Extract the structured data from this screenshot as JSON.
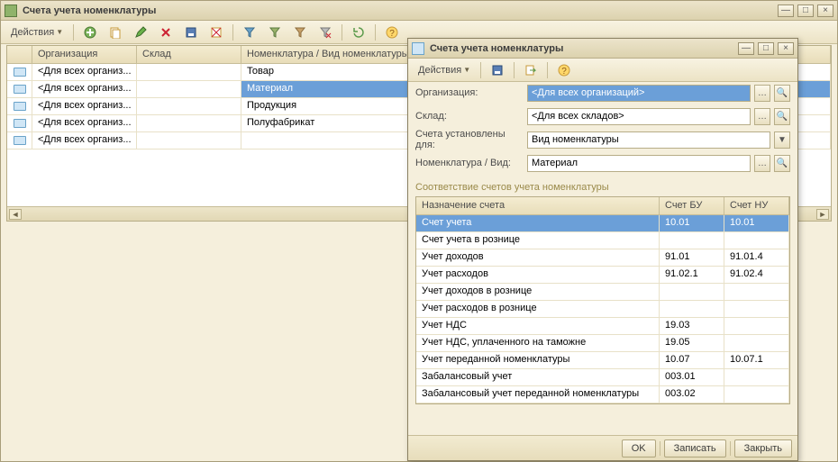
{
  "main": {
    "title": "Счета учета номенклатуры",
    "actions_label": "Действия",
    "columns": {
      "org": "Организация",
      "warehouse": "Склад",
      "nomen": "Номенклатура / Вид номенклатуры"
    },
    "rows": [
      {
        "org": "<Для всех организ...",
        "warehouse": "",
        "nomen": "Товар",
        "selected": false
      },
      {
        "org": "<Для всех организ...",
        "warehouse": "",
        "nomen": "Материал",
        "selected": true
      },
      {
        "org": "<Для всех организ...",
        "warehouse": "",
        "nomen": "Продукция",
        "selected": false
      },
      {
        "org": "<Для всех организ...",
        "warehouse": "",
        "nomen": "Полуфабрикат",
        "selected": false
      },
      {
        "org": "<Для всех организ...",
        "warehouse": "",
        "nomen": "",
        "selected": false
      }
    ]
  },
  "dialog": {
    "title": "Счета учета номенклатуры",
    "actions_label": "Действия",
    "fields": {
      "org_label": "Организация:",
      "org_value": "<Для всех организаций>",
      "warehouse_label": "Склад:",
      "warehouse_value": "<Для всех складов>",
      "setfor_label": "Счета установлены для:",
      "setfor_value": "Вид номенклатуры",
      "nomen_label": "Номенклатура / Вид:",
      "nomen_value": "Материал"
    },
    "section_title": "Соответствие счетов учета номенклатуры",
    "columns": {
      "purpose": "Назначение счета",
      "bu": "Счет БУ",
      "nu": "Счет НУ"
    },
    "rows": [
      {
        "purpose": "Счет учета",
        "bu": "10.01",
        "nu": "10.01",
        "selected": true
      },
      {
        "purpose": "Счет учета в рознице",
        "bu": "",
        "nu": ""
      },
      {
        "purpose": "Учет доходов",
        "bu": "91.01",
        "nu": "91.01.4"
      },
      {
        "purpose": "Учет расходов",
        "bu": "91.02.1",
        "nu": "91.02.4"
      },
      {
        "purpose": "Учет доходов в рознице",
        "bu": "",
        "nu": ""
      },
      {
        "purpose": "Учет расходов в рознице",
        "bu": "",
        "nu": ""
      },
      {
        "purpose": "Учет НДС",
        "bu": "19.03",
        "nu": ""
      },
      {
        "purpose": "Учет НДС, уплаченного на таможне",
        "bu": "19.05",
        "nu": ""
      },
      {
        "purpose": "Учет переданной номенклатуры",
        "bu": "10.07",
        "nu": "10.07.1"
      },
      {
        "purpose": "Забалансовый учет",
        "bu": "003.01",
        "nu": ""
      },
      {
        "purpose": "Забалансовый учет переданной номенклатуры",
        "bu": "003.02",
        "nu": ""
      }
    ],
    "buttons": {
      "ok": "OK",
      "write": "Записать",
      "close": "Закрыть"
    }
  }
}
